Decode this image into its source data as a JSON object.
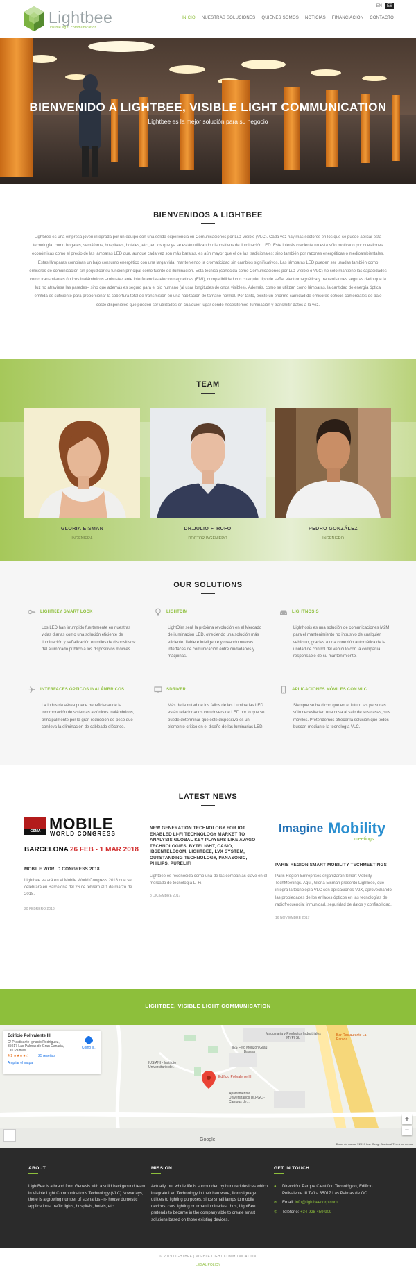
{
  "header": {
    "logo_name": "Lightbee",
    "logo_tagline": "visible light communication",
    "languages": [
      "EN",
      "ES"
    ],
    "active_language": "ES",
    "nav": [
      "INICIO",
      "NUESTRAS SOLUCIONES",
      "QUIÉNES SOMOS",
      "NOTICIAS",
      "FINANCIACIÓN",
      "CONTACTO"
    ],
    "active_nav": "INICIO"
  },
  "hero": {
    "title": "BIENVENIDO A LIGHTBEE, VISIBLE LIGHT COMMUNICATION",
    "subtitle": "Lightbee es la mejor solución para su negocio"
  },
  "welcome": {
    "title": "BIENVENIDOS A LIGHTBEE",
    "text": "LightBee es una empresa joven integrada por un equipo con una sólida experiencia en Comunicaciones por Luz Visible (VLC). Cada vez hay más sectores en los que se puede aplicar esta tecnología, como hogares, semáforos, hospitales, hoteles, etc., en los que ya se están utilizando dispositivos de iluminación LED. Este interés creciente no está sólo motivado por cuestiones económicas como el precio de las lámparas LED que, aunque cada vez son más baratas, es aún mayor que el de las tradicionales; sino también por razones energéticas o medioambientales. Estas lámparas combinan un bajo consumo energético con una larga vida, manteniendo la cromaticidad sin cambios significativos. Las lámparas LED pueden ser usadas también como emisores de comunicación sin perjudicar su función principal como fuente de iluminación. Esta técnica (conocida como Comunicaciones por Luz Visible o VLC) no sólo mantiene las capacidades como transmisores ópticos inalámbricos –robustez ante interferencias electromagnéticas (EMI), compatibilidad con cualquier tipo de señal electromagnética y transmisiones seguras dado que la luz no atraviesa las paredes– sino que además es seguro para el ojo humano (al usar longitudes de onda visibles). Además, como se utilizan como lámparas, la cantidad de energía óptica emitida es suficiente para proporcionar la cobertura total de transmisión en una habitación de tamaño normal. Por tanto, existe un enorme cantidad de emisores ópticos comerciales de bajo coste disponibles que pueden ser utilizados en cualquier lugar donde necesitemos iluminación y transmitir datos a la vez."
  },
  "team": {
    "title": "TEAM",
    "members": [
      {
        "name": "GLORIA EISMAN",
        "role": "INGENIERA"
      },
      {
        "name": "DR.JULIO F. RUFO",
        "role": "DOCTOR INGENIERO"
      },
      {
        "name": "PEDRO GONZÁLEZ",
        "role": "INGENIERO"
      }
    ]
  },
  "solutions": {
    "title": "OUR SOLUTIONS",
    "items": [
      {
        "icon": "key-icon",
        "title": "LIGHTKEY SMART LOCK",
        "text": "Los LED han irrumpido fuertemente en nuestras vidas diarias como una solución eficiente de iluminación y señalización en miles de dispositivos: del alumbrado público a los dispositivos móviles."
      },
      {
        "icon": "lightbulb-icon",
        "title": "LIGHTDIM",
        "text": "LightDim será la próxima revolución en el Mercado de iluminación LED, ofreciendo una solución más eficiente, fiable e inteligente y creando nuevas interfaces de comunicación entre ciudadanos y máquinas."
      },
      {
        "icon": "car-icon",
        "title": "LIGHTNOSIS",
        "text": "Lighthosis es una solución de comunicaciones M2M para el mantenimiento no intrusivo de cualquier vehículo, gracias a una conexión automática de la unidad de control del vehículo con la compañía responsable de su mantenimiento."
      },
      {
        "icon": "plane-icon",
        "title": "INTERFACES ÓPTICOS INALÁMBRICOS",
        "text": "La industria aérea puede beneficiarse de la incorporación de sistemas aviónicos inalámbricos, principalmente por la gran reducción de peso que conlleva la eliminación de cableado eléctrico."
      },
      {
        "icon": "monitor-icon",
        "title": "SDRIVER",
        "text": "Más de la mitad de los fallos de las Luminarias LED están relacionados con drivers de LED por lo que se puede determinar que este dispositivo es un elemento crítico en el diseño de las luminarias LED."
      },
      {
        "icon": "mobile-icon",
        "title": "APLICACIONES MÓVILES CON VLC",
        "text": "Siempre se ha dicho que en el futuro las personas sólo necesitarían una cosa al salir de sus casas, sus móviles. Pretendemos ofrecer la solución que todos buscan mediante la tecnología VLC."
      }
    ]
  },
  "news": {
    "title": "LATEST NEWS",
    "items": [
      {
        "logo_main": "MOBILE",
        "logo_sub": "WORLD CONGRESS",
        "logo_gsma": "GSMA",
        "logo_city": "BARCELONA",
        "logo_dates": "26 FEB - 1 MAR 2018",
        "title": "MOBILE WORLD CONGRESS 2018",
        "text": "Lightbee estará en el Mobile World Congress 2018 que se celebrará en Barcelona del 26 de febrero al 1 de marzo de 2018.",
        "date": "20 FEBRERO 2018"
      },
      {
        "title": "NEW GENERATION TECHNOLOGY FOR IOT ENABLED LI-FI TECHNOLOGY MARKET TO ANALYSIS GLOBAL KEY PLAYERS LIKE AVAGO TECHNOLOGIES, BYTELIGHT, CASIO, IBSENTELECOM, LIGHTBEE, LVX SYSTEM, OUTSTANDING TECHNOLOGY, PANASONIC, PHILIPS, PURELIFI",
        "text": "Lightbee es reconocida como una de las compañías clave en el mercado de tecnología Li-Fi.",
        "date": "8 DICIEMBRE 2017"
      },
      {
        "logo_a": "Imagine",
        "logo_b": "Mobility",
        "logo_c": "meetings",
        "title": "PARIS REGION SMART MOBILITY TECHMEETINGS",
        "text": "Paris Region Entreprises organizaron Smart Mobility TechMeetings. Aquí, Gloria Eisman presentó LightBee, que integra la tecnología VLC con aplicaciones V2X, aprovechando las propiedades de los enlaces ópticos en las tecnologías de radiofrecuencia: inmunidad, seguridad de datos y confiabilidad.",
        "date": "16 NOVIEMBRE 2017"
      }
    ]
  },
  "banner": {
    "text": "LIGHTBEE, VISIBLE LIGHT COMMUNICATION"
  },
  "map": {
    "place": "Edificio Polivalente III",
    "address": "C/ Practicante Ignacio Rodríguez, 35017 Las Palmas de Gran Canaria, Las Palmas",
    "rating": "4.1 ★★★★☆",
    "reviews": "25 reseñas",
    "enlarge": "Ampliar el mapa",
    "directions": "Cómo ll...",
    "marker_label": "Edificio Polivalente III",
    "labels": [
      "Maquinaria y Productos Industriales MYPI SL",
      "Bar Restaurante La Parada",
      "IES Felo Monzón Grau Bassas",
      "IUSIANI - Instituto Universitario de...",
      "Apartamentos Universitarios ULPGC - Campus de..."
    ],
    "google": "Google",
    "attribution": "Datos de mapas ©2019 Inst. Geogr. Nacional   Términos de uso"
  },
  "footer": {
    "about_title": "ABOUT",
    "about_text": "LightBee is a brand from Genesis with a solid background team in Visible Light Communications Technology (VLC) Nowadays, there is a growing number of scenarios -in- house domestic applications, traffic lights, hospitals, hotels, etc.",
    "mission_title": "MISSION",
    "mission_text": "Actually, our whole life is surrounded by hundred devices which integrate Led Technology in their hardware, from signage utilities to lighting purposes, since small lamps to mobile devices, cars lighting or urban luminaries. thus, LightBee pretends to became in the company able to create smart solutions based on those existing devices.",
    "contact_title": "GET IN TOUCH",
    "address_label": "Dirección:",
    "address": "Parque Científico Tecnológico, Edificio Polivalente III Tafira 35017 Las Palmas de GC",
    "email_label": "Email:",
    "email": "info@lightbeecorp.com",
    "phone_label": "Teléfono:",
    "phone": "+34 928 459 909"
  },
  "copyright": {
    "text": "© 2019 LIGHTBEE | VISIBLE LIGHT COMMUNICATION",
    "legal": "LEGAL POLICY"
  },
  "colors": {
    "accent": "#8dbf3b",
    "footer": "#2b2b2b",
    "dark_text": "#222222"
  }
}
